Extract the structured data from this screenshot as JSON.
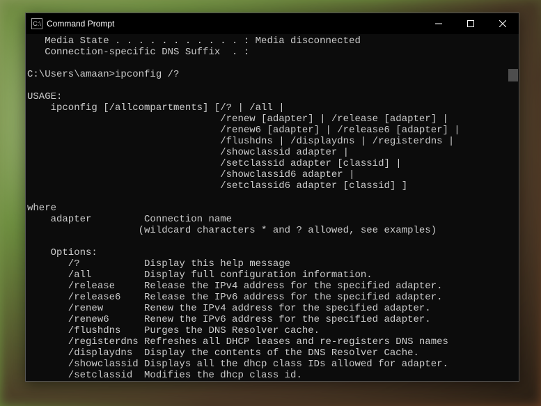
{
  "window": {
    "title": "Command Prompt",
    "icon_glyph": "C:\\"
  },
  "terminal": {
    "lines": [
      "   Media State . . . . . . . . . . . : Media disconnected",
      "   Connection-specific DNS Suffix  . :",
      "",
      "C:\\Users\\amaan>ipconfig /?",
      "",
      "USAGE:",
      "    ipconfig [/allcompartments] [/? | /all |",
      "                                 /renew [adapter] | /release [adapter] |",
      "                                 /renew6 [adapter] | /release6 [adapter] |",
      "                                 /flushdns | /displaydns | /registerdns |",
      "                                 /showclassid adapter |",
      "                                 /setclassid adapter [classid] |",
      "                                 /showclassid6 adapter |",
      "                                 /setclassid6 adapter [classid] ]",
      "",
      "where",
      "    adapter         Connection name",
      "                   (wildcard characters * and ? allowed, see examples)",
      "",
      "    Options:",
      "       /?           Display this help message",
      "       /all         Display full configuration information.",
      "       /release     Release the IPv4 address for the specified adapter.",
      "       /release6    Release the IPv6 address for the specified adapter.",
      "       /renew       Renew the IPv4 address for the specified adapter.",
      "       /renew6      Renew the IPv6 address for the specified adapter.",
      "       /flushdns    Purges the DNS Resolver cache.",
      "       /registerdns Refreshes all DHCP leases and re-registers DNS names",
      "       /displaydns  Display the contents of the DNS Resolver Cache.",
      "       /showclassid Displays all the dhcp class IDs allowed for adapter.",
      "       /setclassid  Modifies the dhcp class id."
    ]
  }
}
